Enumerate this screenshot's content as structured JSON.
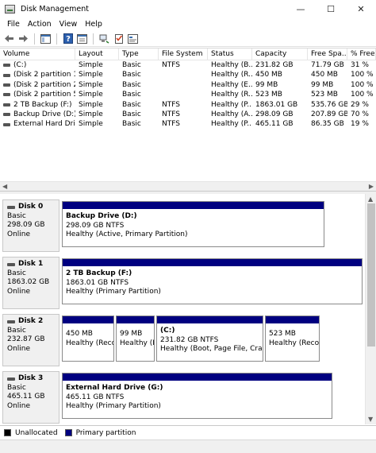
{
  "window": {
    "title": "Disk Management",
    "controls": {
      "minimize": "—",
      "maximize": "☐",
      "close": "✕"
    }
  },
  "menu": [
    "File",
    "Action",
    "View",
    "Help"
  ],
  "toolbar": {
    "icons": [
      "back-arrow-icon",
      "forward-arrow-icon",
      "show-hide-pane-icon",
      "help-icon",
      "properties-icon",
      "connect-icon",
      "checklist-icon",
      "console-icon"
    ]
  },
  "volume_list": {
    "columns": [
      "Volume",
      "Layout",
      "Type",
      "File System",
      "Status",
      "Capacity",
      "Free Spa...",
      "% Free"
    ],
    "rows": [
      [
        "(C:)",
        "Simple",
        "Basic",
        "NTFS",
        "Healthy (B...",
        "231.82 GB",
        "71.79 GB",
        "31 %"
      ],
      [
        "(Disk 2 partition 1)",
        "Simple",
        "Basic",
        "",
        "Healthy (R...",
        "450 MB",
        "450 MB",
        "100 %"
      ],
      [
        "(Disk 2 partition 2)",
        "Simple",
        "Basic",
        "",
        "Healthy (E...",
        "99 MB",
        "99 MB",
        "100 %"
      ],
      [
        "(Disk 2 partition 5)",
        "Simple",
        "Basic",
        "",
        "Healthy (R...",
        "523 MB",
        "523 MB",
        "100 %"
      ],
      [
        "2 TB Backup (F:)",
        "Simple",
        "Basic",
        "NTFS",
        "Healthy (P...",
        "1863.01 GB",
        "535.76 GB",
        "29 %"
      ],
      [
        "Backup Drive (D:)",
        "Simple",
        "Basic",
        "NTFS",
        "Healthy (A...",
        "298.09 GB",
        "207.89 GB",
        "70 %"
      ],
      [
        "External Hard Driv...",
        "Simple",
        "Basic",
        "NTFS",
        "Healthy (P...",
        "465.11 GB",
        "86.35 GB",
        "19 %"
      ]
    ]
  },
  "disks": [
    {
      "name": "Disk 0",
      "type": "Basic",
      "size": "298.09 GB",
      "state": "Online",
      "partitions": [
        {
          "name": "Backup Drive  (D:)",
          "size": "298.09 GB NTFS",
          "status": "Healthy (Active, Primary Partition)"
        }
      ]
    },
    {
      "name": "Disk 1",
      "type": "Basic",
      "size": "1863.02 GB",
      "state": "Online",
      "partitions": [
        {
          "name": "2 TB Backup  (F:)",
          "size": "1863.01 GB NTFS",
          "status": "Healthy (Primary Partition)"
        }
      ]
    },
    {
      "name": "Disk 2",
      "type": "Basic",
      "size": "232.87 GB",
      "state": "Online",
      "partitions": [
        {
          "name": "",
          "size": "450 MB",
          "status": "Healthy (Recov"
        },
        {
          "name": "",
          "size": "99 MB",
          "status": "Healthy (E"
        },
        {
          "name": "(C:)",
          "size": "231.82 GB NTFS",
          "status": "Healthy (Boot, Page File, Crash D"
        },
        {
          "name": "",
          "size": "523 MB",
          "status": "Healthy (Recov"
        }
      ]
    },
    {
      "name": "Disk 3",
      "type": "Basic",
      "size": "465.11 GB",
      "state": "Online",
      "partitions": [
        {
          "name": "External Hard Drive  (G:)",
          "size": "465.11 GB NTFS",
          "status": "Healthy (Primary Partition)"
        }
      ]
    }
  ],
  "legend": [
    {
      "label": "Unallocated",
      "color": "#000000"
    },
    {
      "label": "Primary partition",
      "color": "#000080"
    }
  ]
}
